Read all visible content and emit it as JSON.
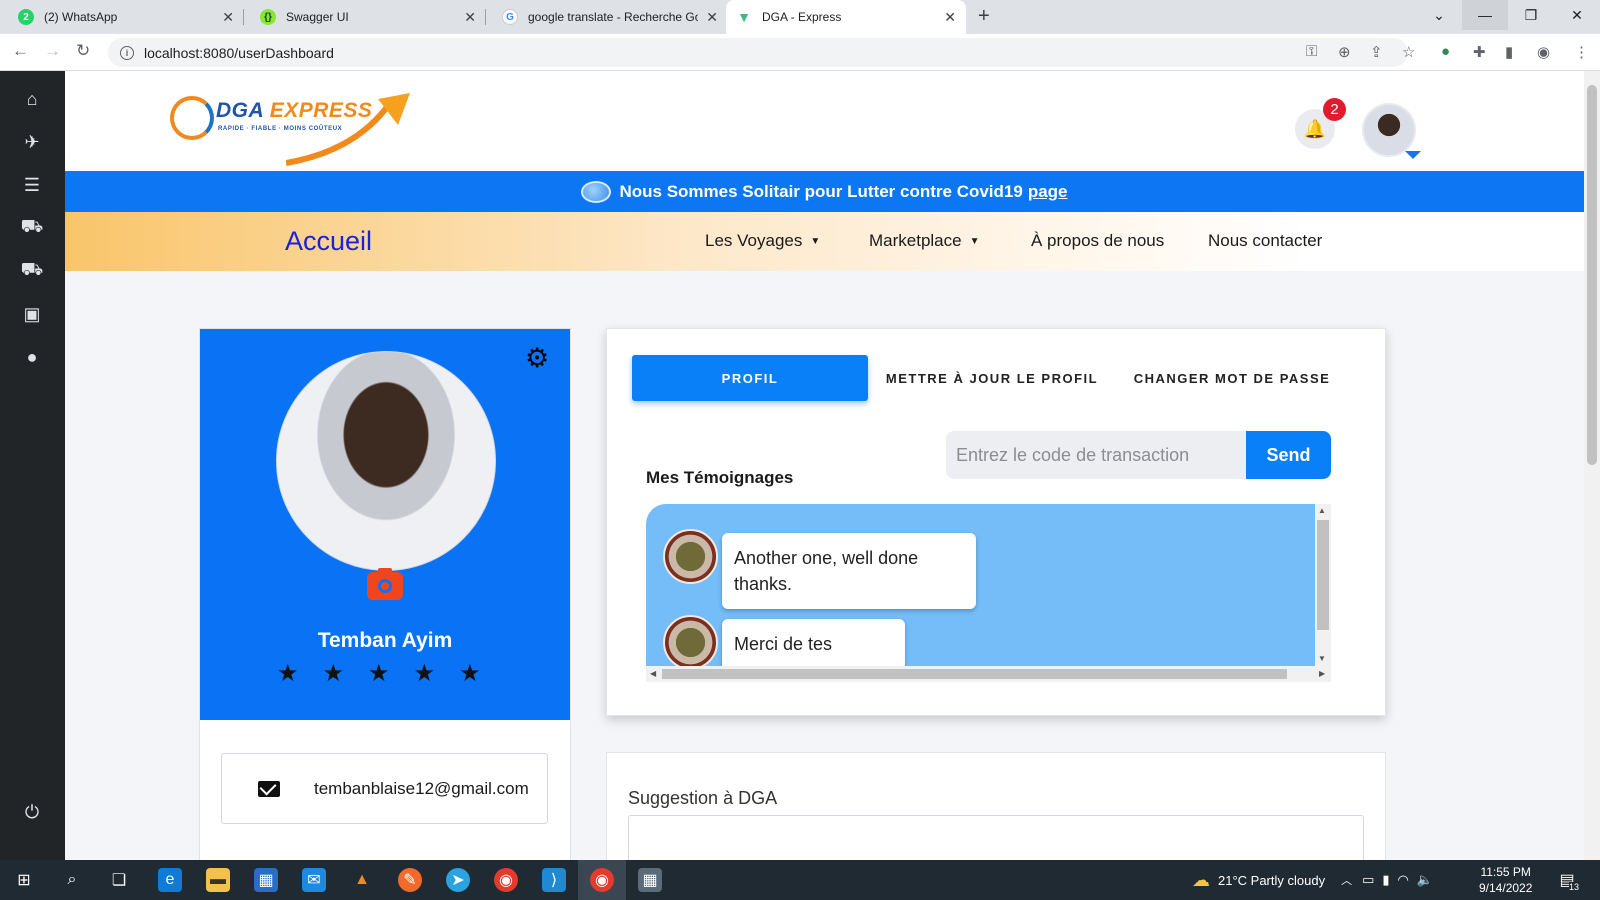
{
  "browser": {
    "tabs": [
      {
        "title": "(2) WhatsApp",
        "icon": "whatsapp-icon"
      },
      {
        "title": "Swagger UI",
        "icon": "swagger-icon"
      },
      {
        "title": "google translate - Recherche Goo",
        "icon": "google-icon"
      },
      {
        "title": "DGA - Express",
        "icon": "vue-icon"
      }
    ],
    "url": "localhost:8080/userDashboard"
  },
  "header": {
    "logo_name_a": "DGA ",
    "logo_name_b": "EXPRESS",
    "logo_tagline": "RAPIDE · FIABLE · MOINS COÛTEUX",
    "notification_count": "2"
  },
  "banner": {
    "text": "Nous Sommes Solitair pour Lutter contre Covid19",
    "link": "page"
  },
  "nav": {
    "home": "Accueil",
    "items": [
      "Les Voyages",
      "Marketplace",
      "À propos de nous",
      "Nous contacter"
    ]
  },
  "profile": {
    "name": "Temban Ayim",
    "rating": 5,
    "email": "tembanblaise12@gmail.com"
  },
  "tabs": {
    "profile": "PROFIL",
    "update": "METTRE À JOUR LE PROFIL",
    "password": "CHANGER MOT DE PASSE"
  },
  "transaction": {
    "placeholder": "Entrez le code de transaction",
    "send": "Send"
  },
  "testimonials": {
    "title": "Mes Témoignages",
    "items": [
      {
        "line1": "Another one, well done",
        "line2": "thanks."
      },
      {
        "line1": "Merci de tes",
        "line2": ""
      }
    ]
  },
  "suggestion": {
    "label": "Suggestion à DGA"
  },
  "taskbar": {
    "weather": "21°C  Partly cloudy",
    "time": "11:55 PM",
    "date": "9/14/2022",
    "notif": "13"
  },
  "colors": {
    "primary": "#0a73f5",
    "sidebar": "#222528",
    "camera": "#f0461f",
    "badge": "#e21b2c"
  }
}
